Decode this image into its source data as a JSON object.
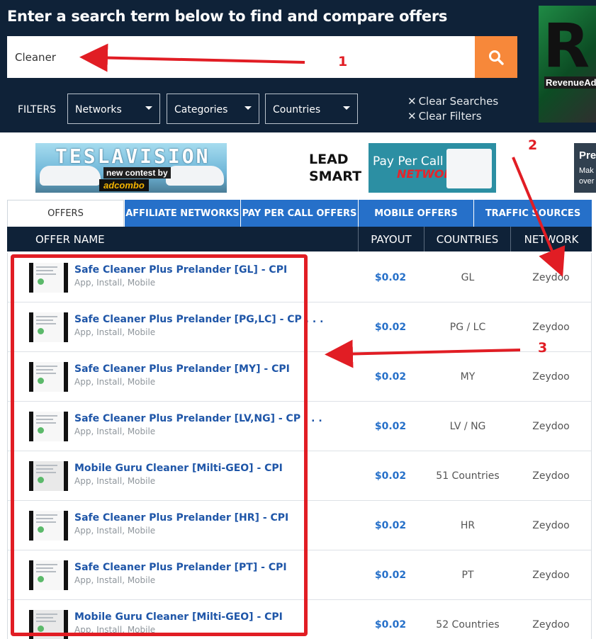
{
  "header": {
    "title": "Enter a search term below to find and compare offers",
    "search_value": "Cleaner",
    "search_icon": "search-icon"
  },
  "filters": {
    "label": "FILTERS",
    "selects": [
      "Networks",
      "Categories",
      "Countries"
    ],
    "clear_searches": "Clear Searches",
    "clear_filters": "Clear Filters"
  },
  "ads": {
    "revenue": {
      "letter": "R",
      "text": "RevenueAds"
    },
    "tesla": {
      "title": "TESLAVISION",
      "tag": "new contest by",
      "brand": "adcombo"
    },
    "lead": {
      "logo_top": "LEAD",
      "logo_bottom": "SMART",
      "line1": "Pay Per Call",
      "line2": "NETWORK"
    },
    "pre": {
      "title": "Pre",
      "line1": "Mak",
      "line2": "over"
    }
  },
  "tabs": [
    "OFFERS",
    "AFFILIATE NETWORKS",
    "PAY PER CALL OFFERS",
    "MOBILE OFFERS",
    "TRAFFIC SOURCES"
  ],
  "columns": {
    "offer_name": "OFFER NAME",
    "payout": "PAYOUT",
    "countries": "COUNTRIES",
    "network": "NETWORK"
  },
  "rows": [
    {
      "name": "Safe Cleaner Plus Prelander [GL] - CPI",
      "tags": "App, Install, Mobile",
      "payout": "$0.02",
      "countries": "GL",
      "network": "Zeydoo"
    },
    {
      "name": "Safe Cleaner Plus Prelander [PG,LC] - CP . . .",
      "tags": "App, Install, Mobile",
      "payout": "$0.02",
      "countries": "PG / LC",
      "network": "Zeydoo"
    },
    {
      "name": "Safe Cleaner Plus Prelander [MY] - CPI",
      "tags": "App, Install, Mobile",
      "payout": "$0.02",
      "countries": "MY",
      "network": "Zeydoo"
    },
    {
      "name": "Safe Cleaner Plus Prelander [LV,NG] - CP . . .",
      "tags": "App, Install, Mobile",
      "payout": "$0.02",
      "countries": "LV / NG",
      "network": "Zeydoo"
    },
    {
      "name": "Mobile Guru Cleaner [Milti-GEO] - CPI",
      "tags": "App, Install, Mobile",
      "payout": "$0.02",
      "countries": "51 Countries",
      "network": "Zeydoo"
    },
    {
      "name": "Safe Cleaner Plus Prelander [HR] - CPI",
      "tags": "App, Install, Mobile",
      "payout": "$0.02",
      "countries": "HR",
      "network": "Zeydoo"
    },
    {
      "name": "Safe Cleaner Plus Prelander [PT] - CPI",
      "tags": "App, Install, Mobile",
      "payout": "$0.02",
      "countries": "PT",
      "network": "Zeydoo"
    },
    {
      "name": "Mobile Guru Cleaner [Milti-GEO] - CPI",
      "tags": "App, Install, Mobile",
      "payout": "$0.02",
      "countries": "52 Countries",
      "network": "Zeydoo"
    }
  ],
  "annotations": {
    "one": "1",
    "two": "2",
    "three": "3",
    "color": "#e11d24"
  },
  "colors": {
    "header_bg": "#0f2238",
    "search_button": "#f7883a",
    "tab_blue": "#2670c9",
    "link_blue": "#1f56a8"
  }
}
